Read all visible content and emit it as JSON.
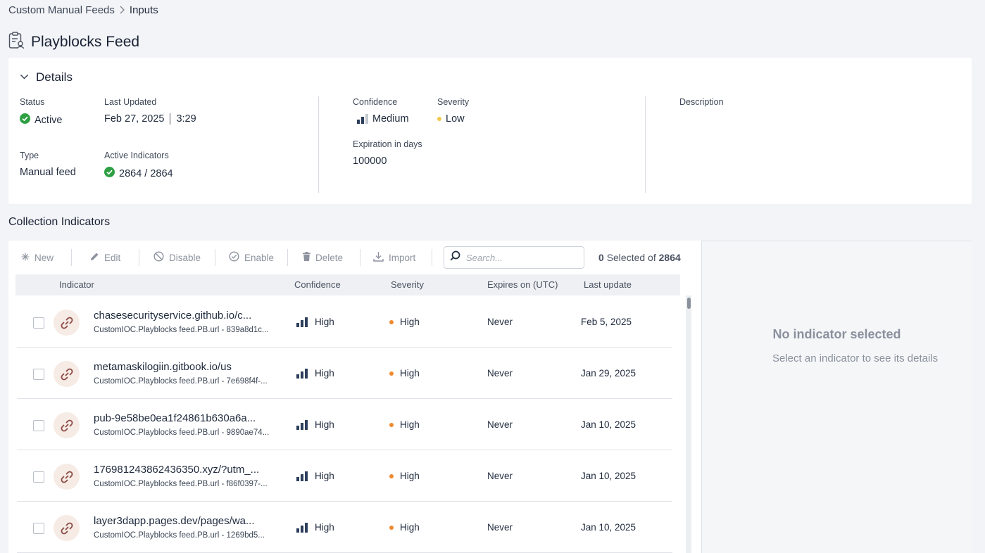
{
  "breadcrumb": {
    "parent": "Custom Manual Feeds",
    "current": "Inputs"
  },
  "page": {
    "title": "Playblocks Feed"
  },
  "details": {
    "header": "Details",
    "status_label": "Status",
    "status_value": "Active",
    "last_updated_label": "Last Updated",
    "last_updated_date": "Feb 27, 2025",
    "last_updated_time": "3:29",
    "type_label": "Type",
    "type_value": "Manual feed",
    "active_indicators_label": "Active Indicators",
    "active_indicators_value": "2864 / 2864",
    "confidence_label": "Confidence",
    "confidence_value": "Medium",
    "severity_label": "Severity",
    "severity_value": "Low",
    "expiration_label": "Expiration in days",
    "expiration_value": "100000",
    "description_label": "Description"
  },
  "collection": {
    "title": "Collection Indicators",
    "toolbar": {
      "new": "New",
      "edit": "Edit",
      "disable": "Disable",
      "enable": "Enable",
      "delete": "Delete",
      "import": "Import",
      "search_placeholder": "Search...",
      "selected_count": "0",
      "selected_text": "Selected of",
      "total": "2864"
    },
    "columns": {
      "indicator": "Indicator",
      "confidence": "Confidence",
      "severity": "Severity",
      "expires": "Expires on (UTC)",
      "last_update": "Last update"
    },
    "rows": [
      {
        "name": "chasesecurityservice.github.io/c...",
        "sub": "CustomIOC.Playblocks feed.PB.url - 839a8d1c...",
        "confidence": "High",
        "severity": "High",
        "expires": "Never",
        "updated": "Feb 5, 2025"
      },
      {
        "name": "metamaskilogiin.gitbook.io/us",
        "sub": "CustomIOC.Playblocks feed.PB.url - 7e698f4f-...",
        "confidence": "High",
        "severity": "High",
        "expires": "Never",
        "updated": "Jan 29, 2025"
      },
      {
        "name": "pub-9e58be0ea1f24861b630a6a...",
        "sub": "CustomIOC.Playblocks feed.PB.url - 9890ae74...",
        "confidence": "High",
        "severity": "High",
        "expires": "Never",
        "updated": "Jan 10, 2025"
      },
      {
        "name": "176981243862436350.xyz/?utm_...",
        "sub": "CustomIOC.Playblocks feed.PB.url - f86f0397-...",
        "confidence": "High",
        "severity": "High",
        "expires": "Never",
        "updated": "Jan 10, 2025"
      },
      {
        "name": "layer3dapp.pages.dev/pages/wa...",
        "sub": "CustomIOC.Playblocks feed.PB.url - 1269bd5...",
        "confidence": "High",
        "severity": "High",
        "expires": "Never",
        "updated": "Jan 10, 2025"
      }
    ]
  },
  "detail_panel": {
    "empty_title": "No indicator selected",
    "empty_subtitle": "Select an indicator to see its details"
  },
  "colors": {
    "active_green": "#2ea043",
    "severity_high": "#ef8a2f",
    "severity_low": "#f2c94c",
    "link_icon": "#8c4a45",
    "bars": "#2d3e5c"
  }
}
